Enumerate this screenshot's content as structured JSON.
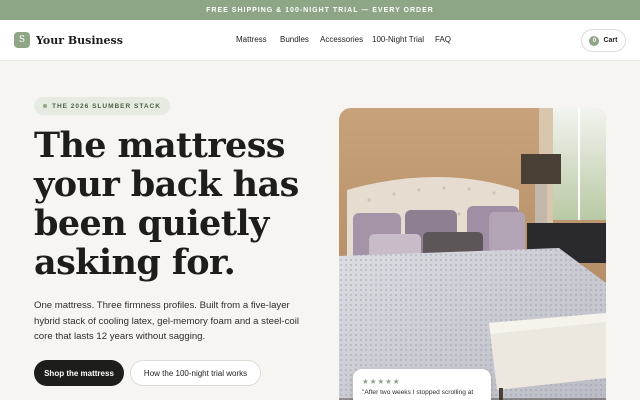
{
  "promo": {
    "text": "FREE SHIPPING & 100-NIGHT TRIAL — EVERY ORDER"
  },
  "header": {
    "logo_mark": "S",
    "brand": "Your Business",
    "nav": [
      "Mattress",
      "Bundles",
      "Accessories",
      "100-Night Trial",
      "FAQ"
    ],
    "cart_count": "0",
    "cart_label": "Cart"
  },
  "hero": {
    "eyebrow": "THE 2026 SLUMBER STACK",
    "headline": "The mattress your back has been quietly asking for.",
    "body": "One mattress. Three firmness profiles. Built from a five-layer hybrid stack of cooling latex, gel-memory foam and a steel-coil core that lasts 12 years without sagging.",
    "cta_primary": "Shop the mattress",
    "cta_secondary": "How the 100-night trial works"
  },
  "review": {
    "stars": "★★★★★",
    "rating": 5,
    "quote": "\"After two weeks I stopped scrolling at"
  },
  "colors": {
    "accent": "#8ea586",
    "dark": "#1d1d1b",
    "background": "#f6f5f2"
  },
  "icons": {
    "photo": "bedroom-photo"
  }
}
